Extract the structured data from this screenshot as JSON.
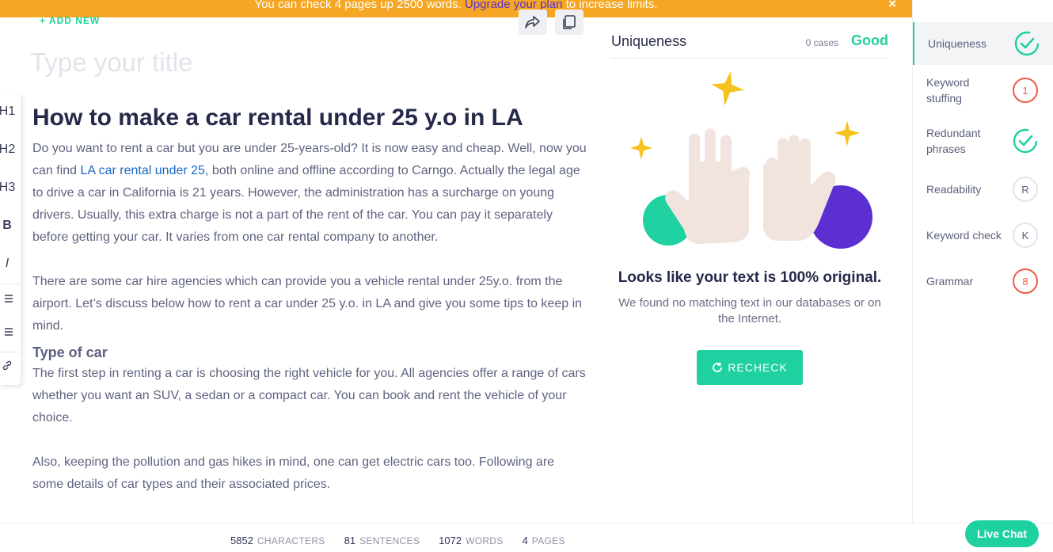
{
  "banner": {
    "text_before": "You can check 4 pages up 2500 words.",
    "link": "Upgrade your plan",
    "text_after": "to increase limits.",
    "close": "×"
  },
  "editor": {
    "add_new": "+ ADD NEW",
    "title_placeholder": "Type your title",
    "toolbar": [
      "H1",
      "H2",
      "H3",
      "B",
      "I"
    ],
    "heading": "How to make a car rental under 25 y.o in LA",
    "p1_before": "Do you want to rent a car but you are under 25-years-old? It is now easy and cheap. Well, now you can find",
    "p1_link": "LA car rental under 25",
    "p1_after": ", both online and offline according to Carngo. Actually the legal age to drive a car in California is 21 years. However, the administration has a surcharge on young drivers. Usually, this extra charge is not a part of the rent of the car. You can pay it separately before getting your car. It varies from one car rental company to another.",
    "p2": "There are some car hire agencies which can provide you a vehicle rental under 25y.o. from the airport. Let’s discuss below how to rent a car under 25 y.o. in LA and give you some tips to keep in mind.",
    "subheading": "Type of car",
    "p3": "The first step in renting a car is choosing the right vehicle for you. All agencies offer a range of cars whether you want an SUV, a sedan or a compact car. You can book and rent the vehicle of your choice.",
    "p4": "Also, keeping the pollution and gas hikes in mind, one can get electric cars too. Following are some details of car types and their associated prices."
  },
  "panel": {
    "title": "Uniqueness",
    "cases": "0 cases",
    "status": "Good",
    "result_title": "Looks like your text is 100% original.",
    "result_sub": "We found no matching text in our databases or on the Internet.",
    "recheck": "RECHECK"
  },
  "sidebar": {
    "items": [
      {
        "label": "Uniqueness",
        "badge": "",
        "state": "ok"
      },
      {
        "label": "Keyword stuffing",
        "badge": "1",
        "state": "error"
      },
      {
        "label": "Redundant phrases",
        "badge": "",
        "state": "ok"
      },
      {
        "label": "Readability",
        "badge": "R",
        "state": "pending"
      },
      {
        "label": "Keyword check",
        "badge": "K",
        "state": "pending"
      },
      {
        "label": "Grammar",
        "badge": "8",
        "state": "error"
      }
    ]
  },
  "stats": {
    "characters": "5852",
    "characters_label": "CHARACTERS",
    "sentences": "81",
    "sentences_label": "SENTENCES",
    "words": "1072",
    "words_label": "WORDS",
    "pages": "4",
    "pages_label": "PAGES"
  },
  "live_chat": "Live Chat",
  "colors": {
    "accent": "#1fd1a0",
    "banner": "#f5a623",
    "error": "#ee5a45",
    "link": "#1a66c7",
    "upgrade": "#5b2fd0"
  }
}
